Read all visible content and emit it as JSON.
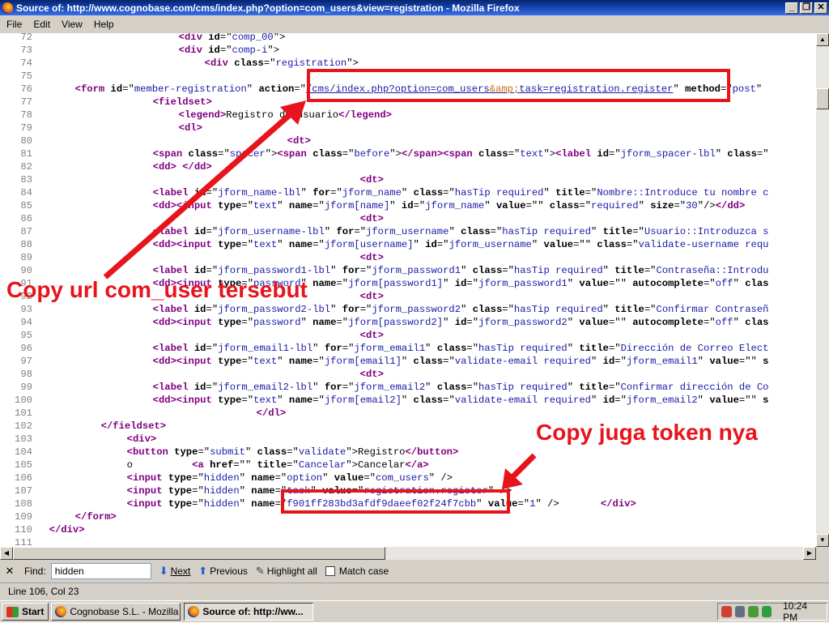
{
  "window": {
    "title": "Source of: http://www.cognobase.com/cms/index.php?option=com_users&view=registration - Mozilla Firefox",
    "minimize": "_",
    "maximize": "❐",
    "close": "✕"
  },
  "menu": [
    "File",
    "Edit",
    "View",
    "Help"
  ],
  "source_lines": [
    {
      "n": "72",
      "html": "<span style=\"display:inline-block;width:166px\"></span><span class=\"tag\">&lt;div</span> <span class=\"attr\">id</span>=\"<span class=\"val\">comp_00</span>\"&gt;"
    },
    {
      "n": "73",
      "html": "<span style=\"display:inline-block;width:166px\"></span><span class=\"tag\">&lt;div</span> <span class=\"attr\">id</span>=\"<span class=\"val\">comp-i</span>\"&gt;"
    },
    {
      "n": "74",
      "html": "<span style=\"display:inline-block;width:198px\"></span><span class=\"tag\">&lt;div</span> <span class=\"attr\">class</span>=\"<span class=\"val\">registration</span>\"&gt;"
    },
    {
      "n": "75",
      "html": ""
    },
    {
      "n": "76",
      "html": "<span style=\"display:inline-block;width:38px\"></span><span class=\"tag\">&lt;form</span> <span class=\"attr\">id</span>=\"<span class=\"val\">member-registration</span>\" <span class=\"attr\">action</span>=\"<span class=\"url\">/cms/index.php?option=com_users<span class=\"amp\">&amp;amp;</span>task=registration.register</span>\" <span class=\"attr\">method</span>=\"<span class=\"val\">post</span>\""
    },
    {
      "n": "77",
      "html": "<span style=\"display:inline-block;width:134px\"></span><span class=\"tag\">&lt;fieldset&gt;</span>"
    },
    {
      "n": "78",
      "html": "<span style=\"display:inline-block;width:166px\"></span><span class=\"tag\">&lt;legend&gt;</span>Registro de usuario<span class=\"tag\">&lt;/legend&gt;</span>"
    },
    {
      "n": "79",
      "html": "<span style=\"display:inline-block;width:166px\"></span><span class=\"tag\">&lt;dl&gt;</span>"
    },
    {
      "n": "80",
      "html": "<span style=\"display:inline-block;width:300px\"></span><span class=\"tag\">&lt;dt&gt;</span>"
    },
    {
      "n": "81",
      "html": "<span style=\"display:inline-block;width:134px\"></span><span class=\"tag\">&lt;span</span> <span class=\"attr\">class</span>=\"<span class=\"val\">spacer</span>\"&gt;<span class=\"tag\">&lt;span</span> <span class=\"attr\">class</span>=\"<span class=\"val\">before</span>\"&gt;<span class=\"tag\">&lt;/span&gt;&lt;span</span> <span class=\"attr\">class</span>=\"<span class=\"val\">text</span>\"&gt;<span class=\"tag\">&lt;label</span> <span class=\"attr\">id</span>=\"<span class=\"val\">jform_spacer-lbl</span>\" <span class=\"attr\">class</span>=\""
    },
    {
      "n": "82",
      "html": "<span style=\"display:inline-block;width:134px\"></span><span class=\"tag\">&lt;dd&gt;</span> <span class=\"tag\">&lt;/dd&gt;</span>"
    },
    {
      "n": "83",
      "html": "<span style=\"display:inline-block;width:390px\"></span><span class=\"tag\">&lt;dt&gt;</span>"
    },
    {
      "n": "84",
      "html": "<span style=\"display:inline-block;width:134px\"></span><span class=\"tag\">&lt;label</span> <span class=\"attr\">id</span>=\"<span class=\"val\">jform_name-lbl</span>\" <span class=\"attr\">for</span>=\"<span class=\"val\">jform_name</span>\" <span class=\"attr\">class</span>=\"<span class=\"val\">hasTip required</span>\" <span class=\"attr\">title</span>=\"<span class=\"val\">Nombre::Introduce tu nombre c</span>"
    },
    {
      "n": "85",
      "html": "<span style=\"display:inline-block;width:134px\"></span><span class=\"tag\">&lt;dd&gt;&lt;input</span> <span class=\"attr\">type</span>=\"<span class=\"val\">text</span>\" <span class=\"attr\">name</span>=\"<span class=\"val\">jform[name]</span>\" <span class=\"attr\">id</span>=\"<span class=\"val\">jform_name</span>\" <span class=\"attr\">value</span>=\"\" <span class=\"attr\">class</span>=\"<span class=\"val\">required</span>\" <span class=\"attr\">size</span>=\"<span class=\"val\">30</span>\"/&gt;<span class=\"tag\">&lt;/dd&gt;</span>"
    },
    {
      "n": "86",
      "html": "<span style=\"display:inline-block;width:390px\"></span><span class=\"tag\">&lt;dt&gt;</span>"
    },
    {
      "n": "87",
      "html": "<span style=\"display:inline-block;width:134px\"></span><span class=\"tag\">&lt;label</span> <span class=\"attr\">id</span>=\"<span class=\"val\">jform_username-lbl</span>\" <span class=\"attr\">for</span>=\"<span class=\"val\">jform_username</span>\" <span class=\"attr\">class</span>=\"<span class=\"val\">hasTip required</span>\" <span class=\"attr\">title</span>=\"<span class=\"val\">Usuario::Introduzca s</span>"
    },
    {
      "n": "88",
      "html": "<span style=\"display:inline-block;width:134px\"></span><span class=\"tag\">&lt;dd&gt;&lt;input</span> <span class=\"attr\">type</span>=\"<span class=\"val\">text</span>\" <span class=\"attr\">name</span>=\"<span class=\"val\">jform[username]</span>\" <span class=\"attr\">id</span>=\"<span class=\"val\">jform_username</span>\" <span class=\"attr\">value</span>=\"\" <span class=\"attr\">class</span>=\"<span class=\"val\">validate-username requ</span>"
    },
    {
      "n": "89",
      "html": "<span style=\"display:inline-block;width:390px\"></span><span class=\"tag\">&lt;dt&gt;</span>"
    },
    {
      "n": "90",
      "html": "<span style=\"display:inline-block;width:134px\"></span><span class=\"tag\">&lt;label</span> <span class=\"attr\">id</span>=\"<span class=\"val\">jform_password1-lbl</span>\" <span class=\"attr\">for</span>=\"<span class=\"val\">jform_password1</span>\" <span class=\"attr\">class</span>=\"<span class=\"val\">hasTip required</span>\" <span class=\"attr\">title</span>=\"<span class=\"val\">Contraseña::Introdu</span>"
    },
    {
      "n": "91",
      "html": "<span style=\"display:inline-block;width:134px\"></span><span class=\"tag\">&lt;dd&gt;&lt;input</span> <span class=\"attr\">type</span>=\"<span class=\"val\">password</span>\" <span class=\"attr\">name</span>=\"<span class=\"val\">jform[password1]</span>\" <span class=\"attr\">id</span>=\"<span class=\"val\">jform_password1</span>\" <span class=\"attr\">value</span>=\"\" <span class=\"attr\">autocomplete</span>=\"<span class=\"val\">off</span>\" <span class=\"attr\">clas</span>"
    },
    {
      "n": "92",
      "html": "<span style=\"display:inline-block;width:390px\"></span><span class=\"tag\">&lt;dt&gt;</span>"
    },
    {
      "n": "93",
      "html": "<span style=\"display:inline-block;width:134px\"></span><span class=\"tag\">&lt;label</span> <span class=\"attr\">id</span>=\"<span class=\"val\">jform_password2-lbl</span>\" <span class=\"attr\">for</span>=\"<span class=\"val\">jform_password2</span>\" <span class=\"attr\">class</span>=\"<span class=\"val\">hasTip required</span>\" <span class=\"attr\">title</span>=\"<span class=\"val\">Confirmar Contraseñ</span>"
    },
    {
      "n": "94",
      "html": "<span style=\"display:inline-block;width:134px\"></span><span class=\"tag\">&lt;dd&gt;&lt;input</span> <span class=\"attr\">type</span>=\"<span class=\"val\">password</span>\" <span class=\"attr\">name</span>=\"<span class=\"val\">jform[password2]</span>\" <span class=\"attr\">id</span>=\"<span class=\"val\">jform_password2</span>\" <span class=\"attr\">value</span>=\"\" <span class=\"attr\">autocomplete</span>=\"<span class=\"val\">off</span>\" <span class=\"attr\">clas</span>"
    },
    {
      "n": "95",
      "html": "<span style=\"display:inline-block;width:390px\"></span><span class=\"tag\">&lt;dt&gt;</span>"
    },
    {
      "n": "96",
      "html": "<span style=\"display:inline-block;width:134px\"></span><span class=\"tag\">&lt;label</span> <span class=\"attr\">id</span>=\"<span class=\"val\">jform_email1-lbl</span>\" <span class=\"attr\">for</span>=\"<span class=\"val\">jform_email1</span>\" <span class=\"attr\">class</span>=\"<span class=\"val\">hasTip required</span>\" <span class=\"attr\">title</span>=\"<span class=\"val\">Dirección de Correo Elect</span>"
    },
    {
      "n": "97",
      "html": "<span style=\"display:inline-block;width:134px\"></span><span class=\"tag\">&lt;dd&gt;&lt;input</span> <span class=\"attr\">type</span>=\"<span class=\"val\">text</span>\" <span class=\"attr\">name</span>=\"<span class=\"val\">jform[email1]</span>\" <span class=\"attr\">class</span>=\"<span class=\"val\">validate-email required</span>\" <span class=\"attr\">id</span>=\"<span class=\"val\">jform_email1</span>\" <span class=\"attr\">value</span>=\"\" <span class=\"attr\">s</span>"
    },
    {
      "n": "98",
      "html": "<span style=\"display:inline-block;width:390px\"></span><span class=\"tag\">&lt;dt&gt;</span>"
    },
    {
      "n": "99",
      "html": "<span style=\"display:inline-block;width:134px\"></span><span class=\"tag\">&lt;label</span> <span class=\"attr\">id</span>=\"<span class=\"val\">jform_email2-lbl</span>\" <span class=\"attr\">for</span>=\"<span class=\"val\">jform_email2</span>\" <span class=\"attr\">class</span>=\"<span class=\"val\">hasTip required</span>\" <span class=\"attr\">title</span>=\"<span class=\"val\">Confirmar dirección de Co</span>"
    },
    {
      "n": "100",
      "html": "<span style=\"display:inline-block;width:134px\"></span><span class=\"tag\">&lt;dd&gt;&lt;input</span> <span class=\"attr\">type</span>=\"<span class=\"val\">text</span>\" <span class=\"attr\">name</span>=\"<span class=\"val\">jform[email2]</span>\" <span class=\"attr\">class</span>=\"<span class=\"val\">validate-email required</span>\" <span class=\"attr\">id</span>=\"<span class=\"val\">jform_email2</span>\" <span class=\"attr\">value</span>=\"\" <span class=\"attr\">s</span>"
    },
    {
      "n": "101",
      "html": "<span style=\"display:inline-block;width:262px\"></span><span class=\"tag\">&lt;/dl&gt;</span>"
    },
    {
      "n": "102",
      "html": "<span style=\"display:inline-block;width:70px\"></span><span class=\"tag\">&lt;/fieldset&gt;</span>"
    },
    {
      "n": "103",
      "html": "<span style=\"display:inline-block;width:102px\"></span><span class=\"tag\">&lt;div&gt;</span>"
    },
    {
      "n": "104",
      "html": "<span style=\"display:inline-block;width:102px\"></span><span class=\"tag\">&lt;button</span> <span class=\"attr\">type</span>=\"<span class=\"val\">submit</span>\" <span class=\"attr\">class</span>=\"<span class=\"val\">validate</span>\"&gt;Registro<span class=\"tag\">&lt;/button&gt;</span>"
    },
    {
      "n": "105",
      "html": "<span style=\"display:inline-block;width:102px\"></span>o          <span class=\"tag\">&lt;a</span> <span class=\"attr\">href</span>=\"\" <span class=\"attr\">title</span>=\"<span class=\"val\">Cancelar</span>\"&gt;Cancelar<span class=\"tag\">&lt;/a&gt;</span>"
    },
    {
      "n": "106",
      "html": "<span style=\"display:inline-block;width:102px\"></span><span class=\"tag\">&lt;input</span> <span class=\"attr\">type</span>=\"<span class=\"val\">hidden</span>\" <span class=\"attr\">name</span>=\"<span class=\"val\">option</span>\" <span class=\"attr\">value</span>=\"<span class=\"val\">com_users</span>\" /&gt;"
    },
    {
      "n": "107",
      "html": "<span style=\"display:inline-block;width:102px\"></span><span class=\"tag\">&lt;input</span> <span class=\"attr\">type</span>=\"<span class=\"val\">hidden</span>\" <span class=\"attr\">name</span>=\"<span class=\"val\">task</span>\" <span class=\"attr\">value</span>=\"<span class=\"val\">registration.register</span>\" /&gt;"
    },
    {
      "n": "108",
      "html": "<span style=\"display:inline-block;width:102px\"></span><span class=\"tag\">&lt;input</span> <span class=\"attr\">type</span>=\"<span class=\"val\">hidden</span>\" <span class=\"attr\">name</span>=\"<span class=\"val\">f901ff283bd3afdf9daeef02f24f7cbb</span>\" <span class=\"attr\">value</span>=\"<span class=\"val\">1</span>\" /&gt;       <span class=\"tag\">&lt;/div&gt;</span>"
    },
    {
      "n": "109",
      "html": "<span style=\"display:inline-block;width:38px\"></span><span class=\"tag\">&lt;/form&gt;</span>"
    },
    {
      "n": "110",
      "html": "<span style=\"display:inline-block;width:6px\"></span><span class=\"tag\">&lt;/div&gt;</span>"
    },
    {
      "n": "111",
      "html": ""
    }
  ],
  "annotations": {
    "url_note": "Copy url com_user tersebut",
    "token_note": "Copy juga token nya",
    "color": "#e8141c"
  },
  "findbar": {
    "close": "✕",
    "label": "Find:",
    "value": "hidden",
    "next": "Next",
    "previous": "Previous",
    "highlight_all": "Highlight all",
    "match_case": "Match case"
  },
  "status": "Line 106, Col 23",
  "taskbar": {
    "start": "Start",
    "buttons": [
      "Cognobase S.L. - Mozilla ...",
      "Source of: http://ww..."
    ],
    "clock": "10:24 PM"
  }
}
